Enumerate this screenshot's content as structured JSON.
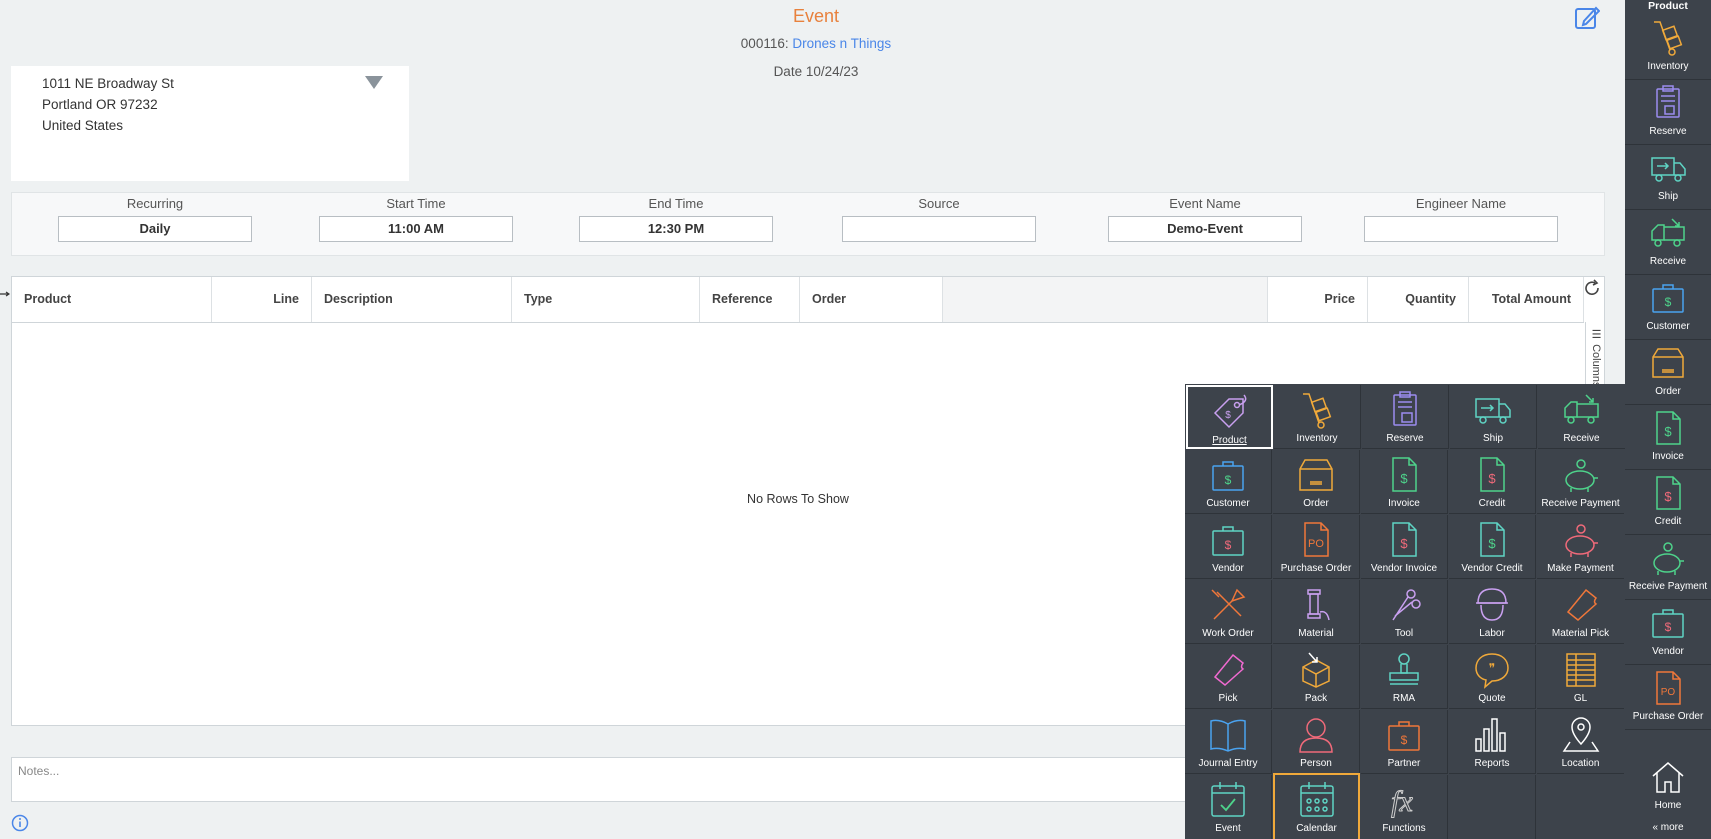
{
  "header": {
    "title": "Event",
    "doc_number": "000116:",
    "doc_name": "Drones n Things",
    "date_label": "Date",
    "date_value": "10/24/23"
  },
  "address": {
    "line1": "1011 NE Broadway St",
    "line2": "Portland OR 97232",
    "line3": "United States"
  },
  "fields": [
    {
      "label": "Recurring",
      "value": "Daily"
    },
    {
      "label": "Start Time",
      "value": "11:00 AM"
    },
    {
      "label": "End Time",
      "value": "12:30 PM"
    },
    {
      "label": "Source",
      "value": ""
    },
    {
      "label": "Event Name",
      "value": "Demo-Event"
    },
    {
      "label": "Engineer Name",
      "value": ""
    }
  ],
  "grid": {
    "columns": [
      "Product",
      "Line",
      "Description",
      "Type",
      "Reference",
      "Order",
      "",
      "Price",
      "Quantity",
      "Total Amount"
    ],
    "empty_text": "No Rows To Show",
    "columns_tab": "Columns"
  },
  "notes": {
    "placeholder": "Notes..."
  },
  "sidebar": {
    "top_label": "Product",
    "items": [
      "Inventory",
      "Reserve",
      "Ship",
      "Receive",
      "Customer",
      "Order",
      "Invoice",
      "Credit",
      "Receive Payment",
      "Vendor",
      "Purchase Order"
    ],
    "home": "Home",
    "more": "« more"
  },
  "menu": {
    "items": [
      {
        "label": "Product",
        "icon": "tag-icon",
        "color": "#c9a0f0"
      },
      {
        "label": "Inventory",
        "icon": "hand-truck-icon",
        "color": "#f0a93a"
      },
      {
        "label": "Reserve",
        "icon": "clipboard-box-icon",
        "color": "#9b8cf0"
      },
      {
        "label": "Ship",
        "icon": "truck-out-icon",
        "color": "#5fd4c4"
      },
      {
        "label": "Receive",
        "icon": "truck-in-icon",
        "color": "#4ed38b"
      },
      {
        "label": "Customer",
        "icon": "briefcase-dollar-icon",
        "color": "#4aa3f0"
      },
      {
        "label": "Order",
        "icon": "box-icon",
        "color": "#f0a93a"
      },
      {
        "label": "Invoice",
        "icon": "doc-dollar-icon",
        "color": "#4ed38b"
      },
      {
        "label": "Credit",
        "icon": "doc-dollar-icon",
        "color": "#4ed38b"
      },
      {
        "label": "Receive Payment",
        "icon": "piggy-bank-icon",
        "color": "#4ed38b"
      },
      {
        "label": "Vendor",
        "icon": "briefcase-dollar-icon",
        "color": "#5fd4c4"
      },
      {
        "label": "Purchase Order",
        "icon": "doc-po-icon",
        "color": "#f0773a"
      },
      {
        "label": "Vendor Invoice",
        "icon": "doc-dollar-icon",
        "color": "#5fd4c4"
      },
      {
        "label": "Vendor Credit",
        "icon": "doc-dollar-icon",
        "color": "#5fd4c4"
      },
      {
        "label": "Make Payment",
        "icon": "piggy-bank-icon",
        "color": "#f06a7a"
      },
      {
        "label": "Work Order",
        "icon": "tools-icon",
        "color": "#f0773a"
      },
      {
        "label": "Material",
        "icon": "spool-icon",
        "color": "#c9a0f0"
      },
      {
        "label": "Tool",
        "icon": "scissors-icon",
        "color": "#c9a0f0"
      },
      {
        "label": "Labor",
        "icon": "hardhat-icon",
        "color": "#c9a0f0"
      },
      {
        "label": "Material Pick",
        "icon": "ticket-icon",
        "color": "#f0773a"
      },
      {
        "label": "Pick",
        "icon": "ticket-icon",
        "color": "#f06ad0"
      },
      {
        "label": "Pack",
        "icon": "pack-icon",
        "color": "#f0a93a"
      },
      {
        "label": "RMA",
        "icon": "stamp-icon",
        "color": "#5fd4c4"
      },
      {
        "label": "Quote",
        "icon": "speech-bubble-icon",
        "color": "#f0a93a"
      },
      {
        "label": "GL",
        "icon": "ledger-icon",
        "color": "#f0a93a"
      },
      {
        "label": "Journal Entry",
        "icon": "book-icon",
        "color": "#4aa3f0"
      },
      {
        "label": "Person",
        "icon": "person-icon",
        "color": "#f06a7a"
      },
      {
        "label": "Partner",
        "icon": "briefcase-dollar-icon",
        "color": "#f0773a"
      },
      {
        "label": "Reports",
        "icon": "bar-chart-icon",
        "color": "#ffffff"
      },
      {
        "label": "Location",
        "icon": "map-pin-icon",
        "color": "#ffffff"
      },
      {
        "label": "Event",
        "icon": "calendar-check-icon",
        "color": "#5fd4c4"
      },
      {
        "label": "Calendar",
        "icon": "calendar-grid-icon",
        "color": "#5fd4c4"
      },
      {
        "label": "Functions",
        "icon": "fx-icon",
        "color": "#cccccc"
      }
    ]
  },
  "colors": {
    "accent": "#e8813d",
    "link": "#4a86e8",
    "menu_bg": "#3d434b",
    "highlight": "#f0a93a"
  }
}
